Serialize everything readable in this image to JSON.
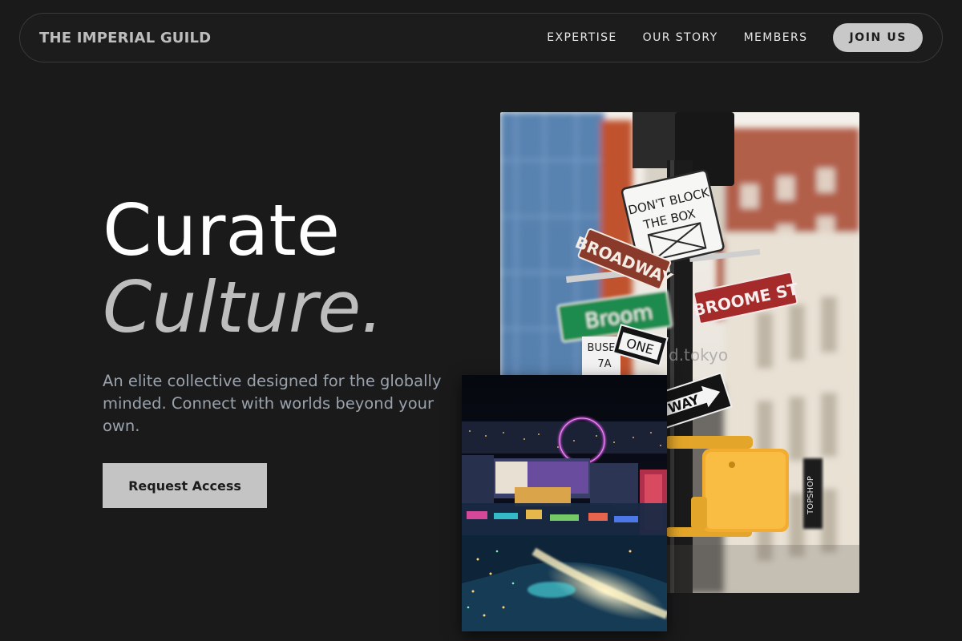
{
  "nav": {
    "brand": "THE IMPERIAL GUILD",
    "links": [
      {
        "label": "EXPERTISE"
      },
      {
        "label": "OUR STORY"
      },
      {
        "label": "MEMBERS"
      }
    ],
    "join_label": "JOIN US"
  },
  "hero": {
    "title_line1": "Curate",
    "title_line2": "Culture.",
    "lede": "An elite collective designed for the globally minded. Connect with worlds beyond your own.",
    "cta_label": "Request Access"
  },
  "images": {
    "street": {
      "signs": {
        "dont_block_1": "DON'T BLOCK",
        "dont_block_2": "THE BOX",
        "broadway": "BROADWAY",
        "broome_green": "Broom",
        "broome_red": "BROOME ST",
        "one": "ONE",
        "way": "WAY",
        "bus": "BUSE",
        "bus_num": "7A",
        "topshop": "TOPSHOP",
        "watermark": "d.tokyo"
      }
    }
  },
  "colors": {
    "background": "#1a1a1b",
    "accent_button": "#c4c4c4",
    "lede_text": "#9aa3ad"
  }
}
